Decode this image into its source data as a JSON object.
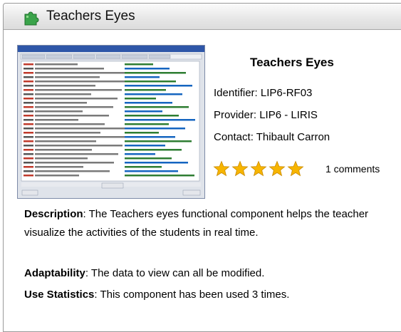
{
  "panel": {
    "title": "Teachers Eyes",
    "icon": "puzzle-piece-icon",
    "accent_color": "#3aa34a"
  },
  "component": {
    "name": "Teachers Eyes",
    "identifier": "Identifier: LIP6-RF03",
    "provider": "Provider: LIP6 - LIRIS",
    "contact": "Contact: Thibault Carron",
    "rating": 5,
    "rating_max": 5,
    "star_color": "#f7b500",
    "comments": "1 comments"
  },
  "screenshot": {
    "icon": "application-screenshot-thumbnail"
  },
  "details": {
    "description_label": "Description",
    "description_text": ": The Teachers eyes functional component helps the teacher visualize the activities of the students in real time.",
    "adaptability_label": "Adaptability",
    "adaptability_text": ": The data to view can all be modified.",
    "stats_label": "Use Statistics",
    "stats_text": ": This component has been used 3 times."
  }
}
